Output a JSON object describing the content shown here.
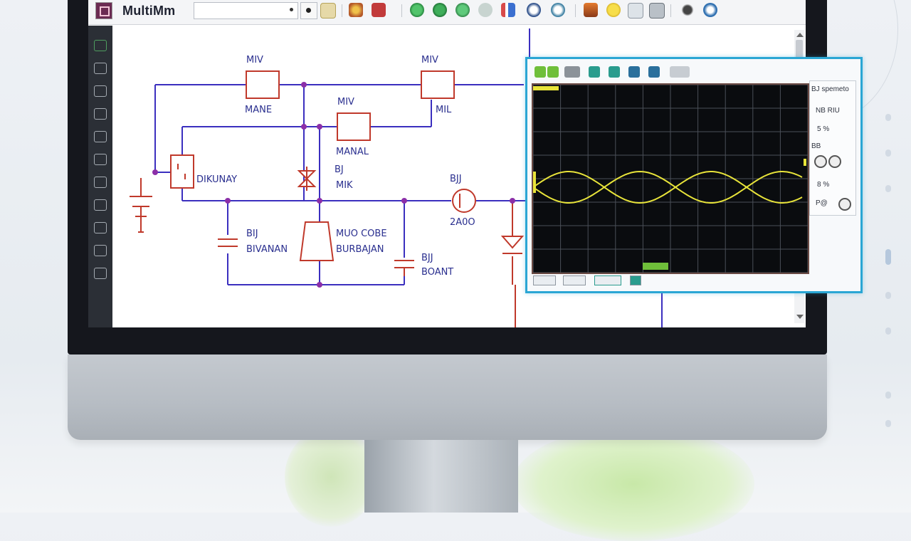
{
  "app": {
    "title": "MultiMm",
    "combo_value": ""
  },
  "toolbar": {
    "icons": [
      "component-icon",
      "probe-icon",
      "run-icon",
      "pause-icon",
      "stop-icon",
      "analysis-icon",
      "grapher-icon",
      "source-icon",
      "meter-icon",
      "help-icon"
    ]
  },
  "schematic": {
    "labels": [
      {
        "id": "r1-value",
        "text": "MIV"
      },
      {
        "id": "r1-name",
        "text": "MANE"
      },
      {
        "id": "r2-value",
        "text": "MIV"
      },
      {
        "id": "r2-name",
        "text": "MIL"
      },
      {
        "id": "r3-value",
        "text": "MIV"
      },
      {
        "id": "r3-name",
        "text": "MANAL"
      },
      {
        "id": "u1-name",
        "text": "DIKUNAY"
      },
      {
        "id": "q1-name",
        "text": "BJ"
      },
      {
        "id": "q1-type",
        "text": "MIK"
      },
      {
        "id": "c1-name",
        "text": "BIJ"
      },
      {
        "id": "c1-type",
        "text": "BIVANAN"
      },
      {
        "id": "amp-name",
        "text": "MUO COBE"
      },
      {
        "id": "amp-type",
        "text": "BURBAJAN"
      },
      {
        "id": "c2-name",
        "text": "BJJ"
      },
      {
        "id": "c2-type",
        "text": "BOANT"
      },
      {
        "id": "src-name",
        "text": "BJJ"
      },
      {
        "id": "src-value",
        "text": "2A0O"
      }
    ]
  },
  "scope": {
    "panel": {
      "title": "BJ spemeto",
      "row1": "NB RIU",
      "row2": "5 %",
      "row3": "BB",
      "row4": "8 %",
      "row5": "P@"
    },
    "bottom": {
      "label1": "",
      "label2": "",
      "label3": ""
    },
    "trace_color": "#e8e43a",
    "grid_color": "#4a4f58"
  },
  "colors": {
    "wire": "#3b2fbf",
    "component": "#c0392b",
    "accent": "#2aa6d4"
  }
}
